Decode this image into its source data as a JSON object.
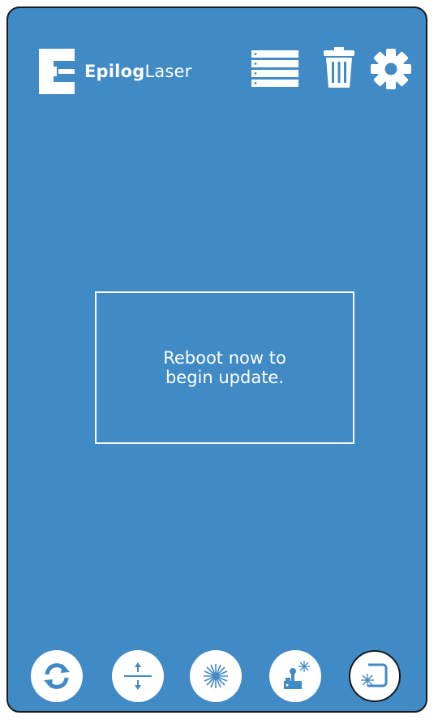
{
  "header": {
    "brand_bold": "Epilog",
    "brand_light": "Laser",
    "icons": [
      "job-list-icon",
      "trash-icon",
      "settings-gear-icon"
    ]
  },
  "dialog": {
    "message": "Reboot now to\nbegin update."
  },
  "bottom_bar": {
    "buttons": [
      {
        "name": "refresh-icon"
      },
      {
        "name": "focus-icon"
      },
      {
        "name": "laser-pointer-icon"
      },
      {
        "name": "jog-icon"
      },
      {
        "name": "frame-icon"
      }
    ]
  },
  "colors": {
    "panel_bg": "#408ac6",
    "foreground": "#ffffff",
    "border": "#1a1a1a"
  }
}
